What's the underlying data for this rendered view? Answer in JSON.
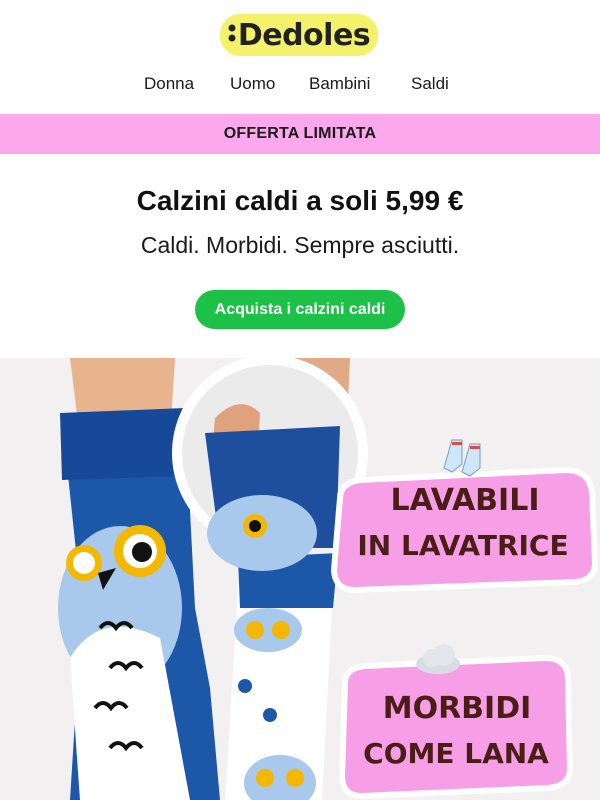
{
  "brand": {
    "name": "Dedoles"
  },
  "nav": {
    "items": [
      "Donna",
      "Uomo",
      "Bambini",
      "Saldi"
    ]
  },
  "promo": {
    "text": "OFFERTA LIMITATA"
  },
  "hero_text": {
    "headline": "Calzini caldi a soli 5,99 €",
    "subheadline": "Caldi. Morbidi. Sempre asciutti.",
    "cta_label": "Acquista i calzini caldi"
  },
  "badges": {
    "washable_line1": "LAVABILI",
    "washable_line2": "IN LAVATRICE",
    "soft_line1": "MORBIDI",
    "soft_line2": "COME LANA"
  },
  "colors": {
    "brand_yellow": "#f4f26a",
    "promo_pink": "#fba8ec",
    "cta_green": "#1ec148",
    "badge_pink": "#f79fe6",
    "badge_text": "#4a1e16",
    "sock_blue": "#1d58a8"
  },
  "icons": {
    "washable": "socks-icon",
    "soft": "cloud-icon"
  }
}
